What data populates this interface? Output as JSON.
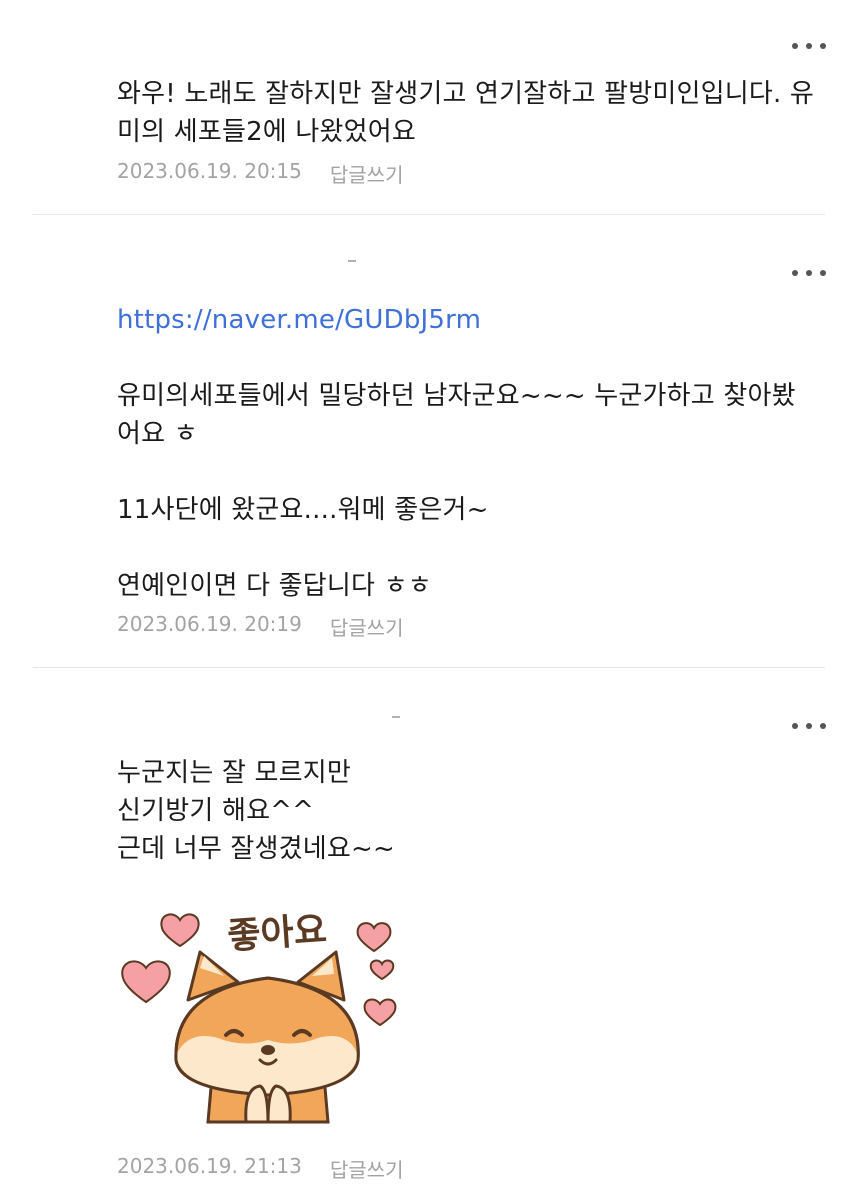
{
  "comments": [
    {
      "more_label": "...",
      "paragraphs": [
        "와우! 노래도 잘하지만 잘생기고 연기잘하고 팔방미인입니다. 유미의 세포들2에 나왔었어요"
      ],
      "timestamp": "2023.06.19. 20:15",
      "reply_label": "답글쓰기"
    },
    {
      "more_label": "...",
      "link": "https://naver.me/GUDbJ5rm",
      "paragraphs": [
        "유미의세포들에서 밀당하던 남자군요~~~ 누군가하고 찾아봤어요 ㅎ",
        "11사단에 왔군요....워메 좋은거~",
        "연예인이면 다 좋답니다 ㅎㅎ"
      ],
      "timestamp": "2023.06.19. 20:19",
      "reply_label": "답글쓰기"
    },
    {
      "more_label": "...",
      "paragraphs": [
        "누군지는 잘 모르지만\n신기방기 해요^^\n근데 너무 잘생겼네요~~"
      ],
      "sticker": {
        "text": "좋아요",
        "icon": "shiba-dog-hearts-sticker",
        "colors": {
          "fur": "#f2a65a",
          "fur_light": "#fde8cc",
          "outline": "#5a3a22",
          "heart": "#f5a0a5",
          "text": "#5a3a22"
        }
      },
      "timestamp": "2023.06.19. 21:13",
      "reply_label": "답글쓰기"
    }
  ],
  "colors": {
    "link": "#3f6fd8",
    "meta": "#a3a3a3",
    "divider": "#e6e6e6",
    "text": "#1b1b1b"
  }
}
